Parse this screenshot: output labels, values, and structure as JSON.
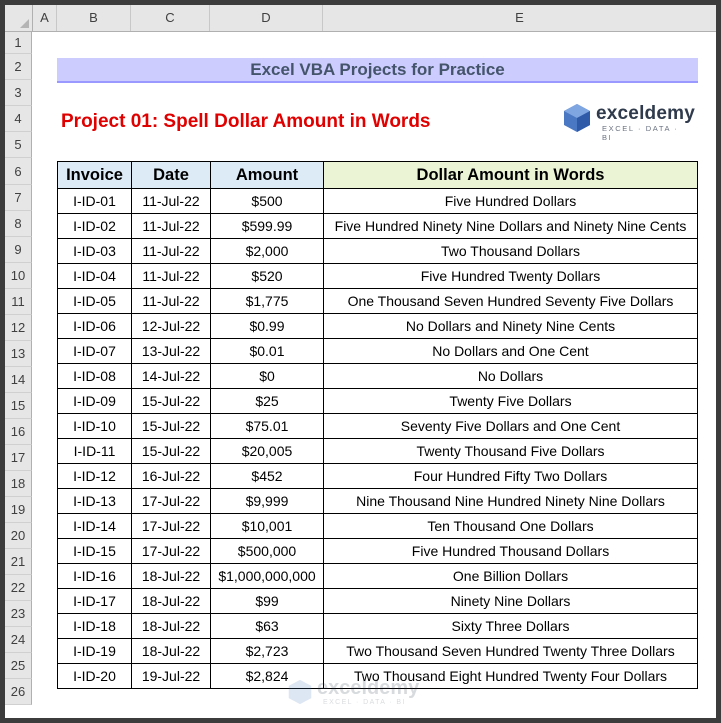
{
  "columns": [
    "A",
    "B",
    "C",
    "D",
    "E"
  ],
  "rows": [
    "1",
    "2",
    "3",
    "4",
    "5",
    "6",
    "7",
    "8",
    "9",
    "10",
    "11",
    "12",
    "13",
    "14",
    "15",
    "16",
    "17",
    "18",
    "19",
    "20",
    "21",
    "22",
    "23",
    "24",
    "25",
    "26"
  ],
  "title": "Excel VBA Projects for Practice",
  "project_title": "Project 01: Spell Dollar Amount in Words",
  "logo": {
    "name": "exceldemy",
    "tagline": "EXCEL · DATA · BI"
  },
  "table": {
    "headers": [
      "Invoice",
      "Date",
      "Amount",
      "Dollar Amount in Words"
    ],
    "rows": [
      [
        "I-ID-01",
        "11-Jul-22",
        "$500",
        "Five Hundred Dollars"
      ],
      [
        "I-ID-02",
        "11-Jul-22",
        "$599.99",
        "Five Hundred Ninety Nine Dollars and Ninety Nine Cents"
      ],
      [
        "I-ID-03",
        "11-Jul-22",
        "$2,000",
        "Two Thousand Dollars"
      ],
      [
        "I-ID-04",
        "11-Jul-22",
        "$520",
        "Five Hundred Twenty Dollars"
      ],
      [
        "I-ID-05",
        "11-Jul-22",
        "$1,775",
        "One Thousand Seven Hundred Seventy Five Dollars"
      ],
      [
        "I-ID-06",
        "12-Jul-22",
        "$0.99",
        "No Dollars and Ninety Nine Cents"
      ],
      [
        "I-ID-07",
        "13-Jul-22",
        "$0.01",
        "No Dollars and One Cent"
      ],
      [
        "I-ID-08",
        "14-Jul-22",
        "$0",
        "No Dollars"
      ],
      [
        "I-ID-09",
        "15-Jul-22",
        "$25",
        "Twenty Five Dollars"
      ],
      [
        "I-ID-10",
        "15-Jul-22",
        "$75.01",
        "Seventy Five Dollars and One Cent"
      ],
      [
        "I-ID-11",
        "15-Jul-22",
        "$20,005",
        "Twenty Thousand Five Dollars"
      ],
      [
        "I-ID-12",
        "16-Jul-22",
        "$452",
        "Four Hundred Fifty Two Dollars"
      ],
      [
        "I-ID-13",
        "17-Jul-22",
        "$9,999",
        "Nine Thousand Nine Hundred Ninety Nine Dollars"
      ],
      [
        "I-ID-14",
        "17-Jul-22",
        "$10,001",
        "Ten Thousand One Dollars"
      ],
      [
        "I-ID-15",
        "17-Jul-22",
        "$500,000",
        "Five Hundred Thousand Dollars"
      ],
      [
        "I-ID-16",
        "18-Jul-22",
        "$1,000,000,000",
        "One Billion Dollars"
      ],
      [
        "I-ID-17",
        "18-Jul-22",
        "$99",
        "Ninety Nine Dollars"
      ],
      [
        "I-ID-18",
        "18-Jul-22",
        "$63",
        "Sixty Three Dollars"
      ],
      [
        "I-ID-19",
        "18-Jul-22",
        "$2,723",
        "Two Thousand Seven Hundred Twenty Three Dollars"
      ],
      [
        "I-ID-20",
        "19-Jul-22",
        "$2,824",
        "Two Thousand Eight Hundred Twenty Four Dollars"
      ]
    ]
  },
  "colors": {
    "title_band": "#ccccff",
    "project_title": "#e00000",
    "header_blue": "#ddebf7",
    "header_green": "#ebf5d6"
  }
}
